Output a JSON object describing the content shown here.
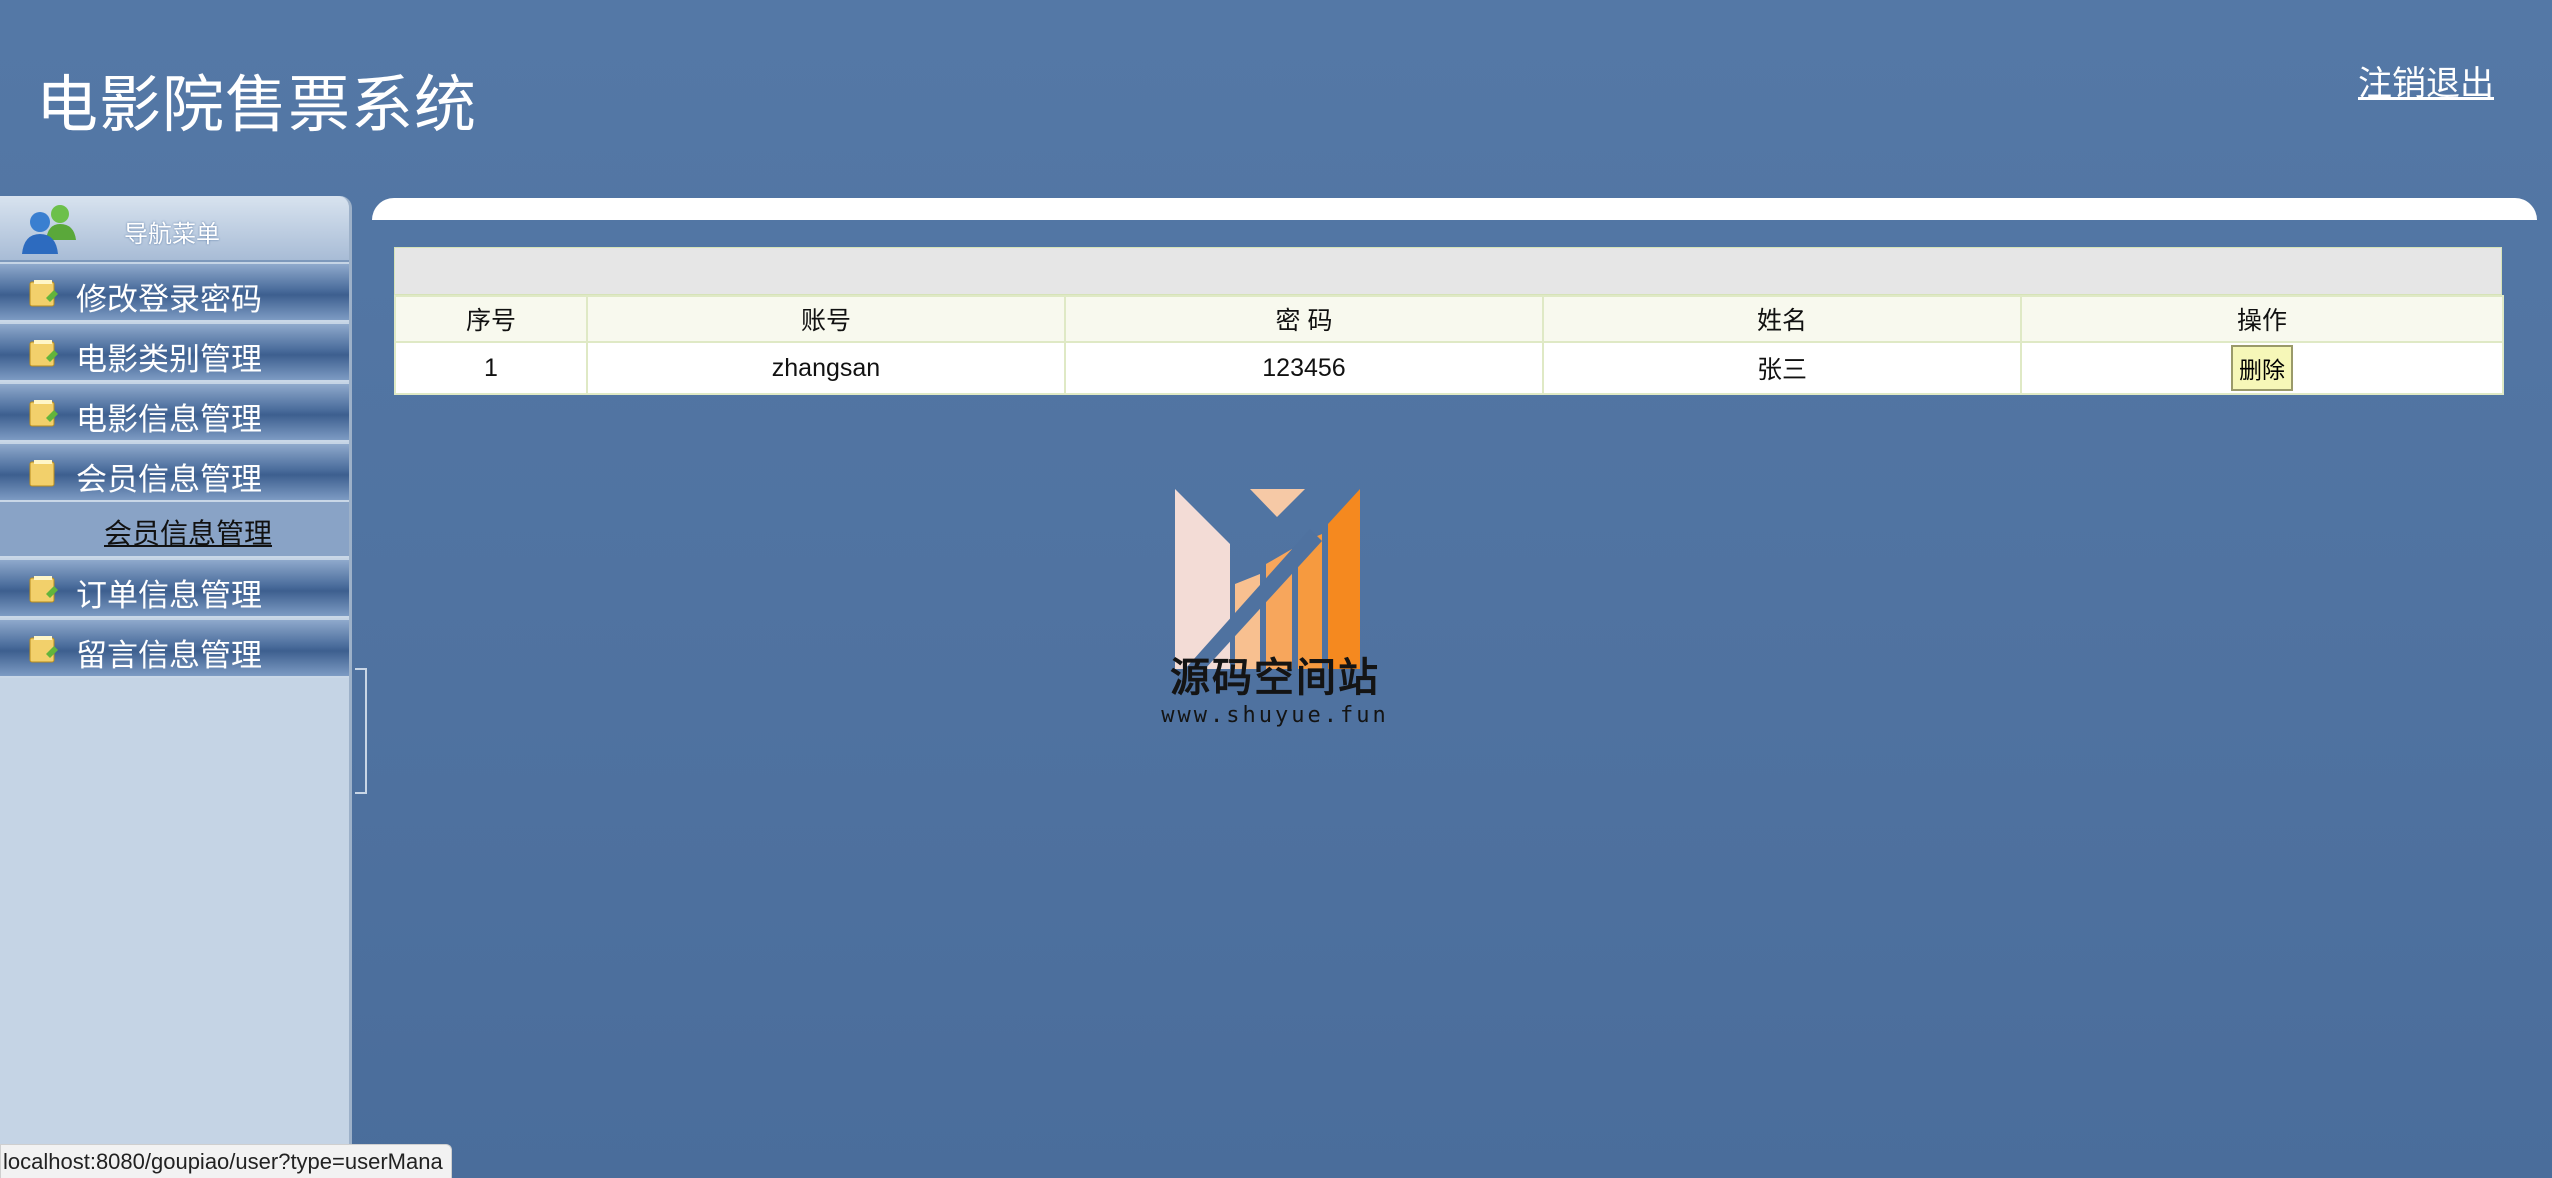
{
  "header": {
    "title": "电影院售票系统",
    "logout_label": "注销退出"
  },
  "sidebar": {
    "header_label": "导航菜单",
    "items": [
      {
        "label": "修改登录密码"
      },
      {
        "label": "电影类别管理"
      },
      {
        "label": "电影信息管理"
      },
      {
        "label": "会员信息管理"
      },
      {
        "label": "订单信息管理"
      },
      {
        "label": "留言信息管理"
      }
    ],
    "sub_items": [
      {
        "label": "会员信息管理"
      }
    ]
  },
  "table": {
    "columns": [
      "序号",
      "账号",
      "密 码",
      "姓名",
      "操作"
    ],
    "rows": [
      {
        "index": "1",
        "account": "zhangsan",
        "password": "123456",
        "name": "张三",
        "action_label": "删除"
      }
    ]
  },
  "watermark": {
    "name": "源码空间站",
    "url": "www.shuyue.fun"
  },
  "statusbar": {
    "url": "localhost:8080/goupiao/user?type=userMana"
  },
  "colors": {
    "background": "#4f72a0",
    "sidebar": "#c5d4e5",
    "logo_orange": "#f5891f",
    "logo_pink": "#f3dcd6"
  }
}
